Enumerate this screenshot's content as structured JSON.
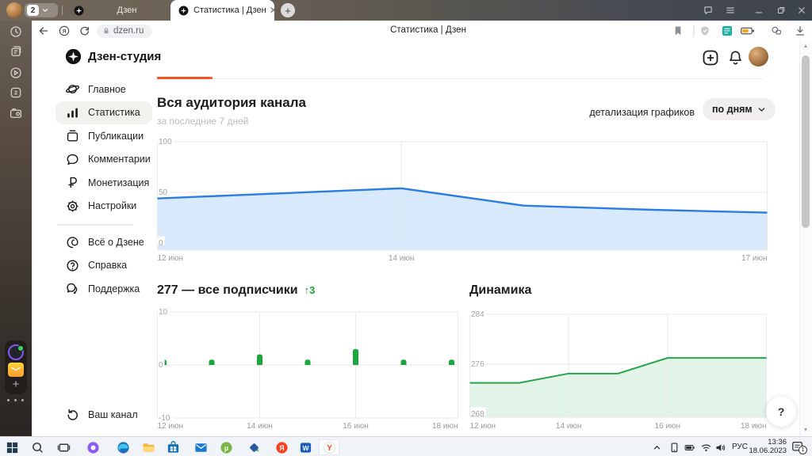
{
  "browser": {
    "tab_group_count": "2",
    "tabs": [
      {
        "title": "Дзен"
      },
      {
        "title": "Статистика | Дзен"
      }
    ],
    "new_tab_label": "+",
    "center_title": "Статистика | Дзен",
    "address": "dzen.ru",
    "left_strip_icons": [
      "history-icon",
      "collections-icon",
      "video-icon",
      "tabs-counter-icon",
      "screenshot-icon"
    ],
    "toolbar_right_icons": [
      "bookmark-icon",
      "shield-icon",
      "translate-extension-icon",
      "battery-extension-icon",
      "extensions-icon",
      "downloads-icon"
    ],
    "window_icons": [
      "feedback-icon",
      "menu-icon",
      "minimize-icon",
      "restore-icon",
      "close-icon"
    ]
  },
  "studio": {
    "brand": "Дзен-студия",
    "nav": [
      {
        "label": "Главное",
        "icon": "planet"
      },
      {
        "label": "Статистика",
        "icon": "stats",
        "active": true
      },
      {
        "label": "Публикации",
        "icon": "publications"
      },
      {
        "label": "Комментарии",
        "icon": "comments"
      },
      {
        "label": "Монетизация",
        "icon": "ruble"
      },
      {
        "label": "Настройки",
        "icon": "gear"
      }
    ],
    "nav_secondary": [
      {
        "label": "Всё о Дзене",
        "icon": "zen"
      },
      {
        "label": "Справка",
        "icon": "help"
      },
      {
        "label": "Поддержка",
        "icon": "support"
      }
    ],
    "footer": {
      "label": "Ваш канал",
      "icon": "back"
    }
  },
  "page": {
    "title": "Вся аудитория канала",
    "subtitle": "за последние 7 дней",
    "detail_label": "детализация графиков",
    "detail_value": "по дням",
    "subscribers_title": "277 — все подписчики",
    "subscribers_delta": "↑3",
    "dynamics_title": "Динамика",
    "help_button": "?"
  },
  "chart_data": [
    {
      "id": "audience",
      "type": "area",
      "title": "Вся аудитория канала",
      "x": [
        12,
        13,
        14,
        15,
        16,
        17
      ],
      "x_unit": "июн",
      "values": [
        44,
        49,
        54,
        37,
        33,
        30
      ],
      "ylim": [
        0,
        100
      ],
      "yticks": [
        0,
        50,
        100
      ],
      "xtick_labels": [
        "12 июн",
        "14 июн",
        "17 июн"
      ],
      "line_color": "#2b7de1",
      "fill_color": "#d9e9fc",
      "grid": true,
      "legend": "none"
    },
    {
      "id": "subscribers",
      "type": "bar",
      "title": "277 — все подписчики",
      "x": [
        12,
        13,
        14,
        15,
        16,
        17,
        18
      ],
      "x_unit": "июн",
      "values": [
        1,
        1,
        2,
        1,
        3,
        1,
        1
      ],
      "ylim": [
        -10,
        10
      ],
      "yticks": [
        -10,
        0,
        10
      ],
      "xtick_labels": [
        "12 июн",
        "14 июн",
        "16 июн",
        "18 июн"
      ],
      "bar_color": "#1aa73e",
      "grid": true,
      "legend": "none"
    },
    {
      "id": "dynamics",
      "type": "area",
      "title": "Динамика",
      "x": [
        12,
        13,
        14,
        15,
        16,
        17,
        18
      ],
      "x_unit": "июн",
      "values": [
        273,
        273,
        274.5,
        274.5,
        277,
        277,
        277
      ],
      "ylim": [
        268,
        284
      ],
      "yticks": [
        268,
        276,
        284
      ],
      "xtick_labels": [
        "12 июн",
        "14 июн",
        "16 июн",
        "18 июн"
      ],
      "line_color": "#27a44c",
      "fill_color": "#e2f3e7",
      "grid": true,
      "legend": "none"
    }
  ],
  "taskbar": {
    "apps": [
      {
        "name": "start"
      },
      {
        "name": "search"
      },
      {
        "name": "task-view"
      },
      {
        "name": "alice"
      },
      {
        "name": "edge"
      },
      {
        "name": "file-explorer"
      },
      {
        "name": "store"
      },
      {
        "name": "mail"
      },
      {
        "name": "utorrent"
      },
      {
        "name": "remote-access"
      },
      {
        "name": "yandex"
      },
      {
        "name": "word",
        "indicator": true
      },
      {
        "name": "yandex-browser",
        "indicator": true,
        "active": true
      }
    ],
    "tray_icons": [
      "chevron-up-icon",
      "device-icon",
      "battery-icon",
      "wifi-icon",
      "volume-icon"
    ],
    "lang": "РУС",
    "time": "13:36",
    "date": "18.06.2023",
    "notification_badge": "1"
  },
  "colors": {
    "accent_orange": "#fc4f1e",
    "blue": "#2b7de1",
    "green": "#1aa73e"
  }
}
